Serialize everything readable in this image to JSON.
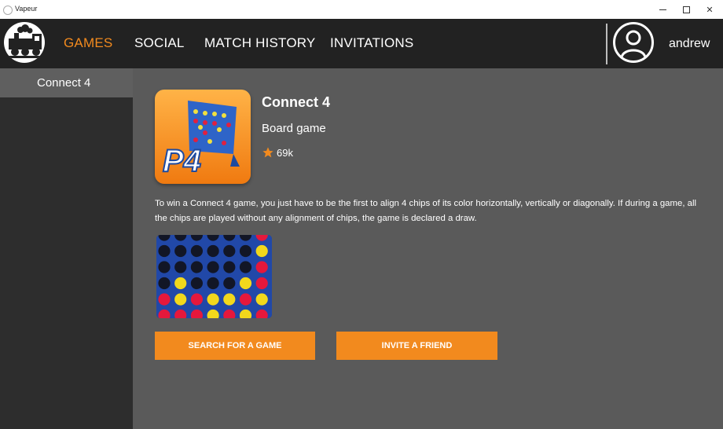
{
  "window": {
    "title": "Vapeur"
  },
  "nav": {
    "items": [
      {
        "label": "GAMES",
        "active": true
      },
      {
        "label": "SOCIAL",
        "active": false
      },
      {
        "label": "MATCH HISTORY",
        "active": false
      },
      {
        "label": "INVITATIONS",
        "active": false
      }
    ],
    "username": "andrew"
  },
  "sidebar": {
    "items": [
      {
        "label": "Connect 4",
        "selected": true
      }
    ]
  },
  "game": {
    "title": "Connect 4",
    "category": "Board game",
    "rating": "69k",
    "icon_text": "P4",
    "description": "To win a Connect 4 game, you just have to be the first to align 4 chips of its color horizontally, vertically or diagonally. If during a game, all the chips are played without any alignment of chips, the game is declared a draw."
  },
  "actions": {
    "search_label": "SEARCH FOR A GAME",
    "invite_label": "INVITE A FRIEND"
  },
  "colors": {
    "accent": "#f28a1e",
    "navbar": "#222222",
    "sidebar": "#2d2d2d",
    "content": "#5a5a5a"
  },
  "icons": {
    "logo": "train-logo-icon",
    "avatar": "user-avatar-icon",
    "rating": "star-icon"
  }
}
